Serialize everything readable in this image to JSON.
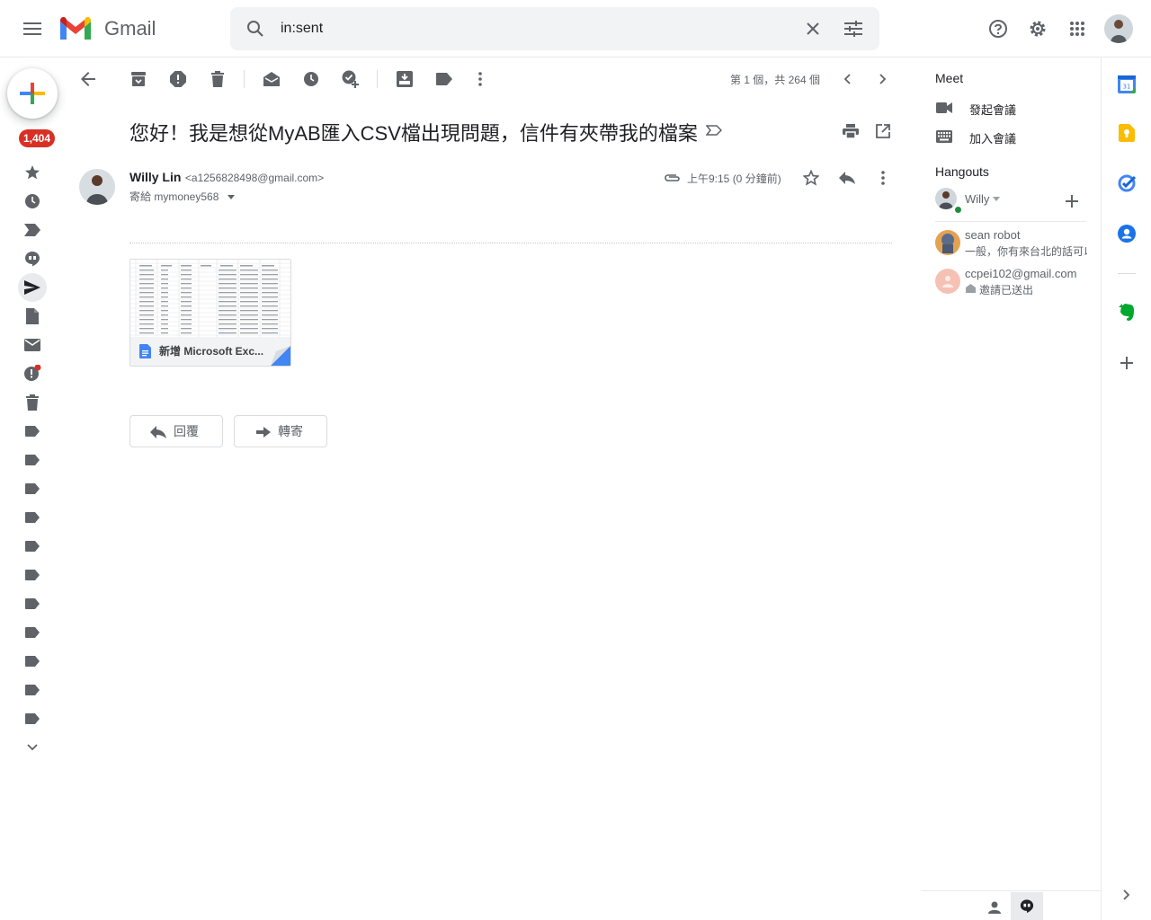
{
  "header": {
    "app_name": "Gmail",
    "search": {
      "value": "in:sent"
    }
  },
  "left_rail": {
    "unread_badge": "1,404"
  },
  "toolbar": {
    "pager": "第 1 個，共 264 個"
  },
  "message": {
    "subject": "您好！我是想從MyAB匯入CSV檔出現問題，信件有夾帶我的檔案",
    "sender_name": "Willy Lin",
    "sender_email": "<a1256828498@gmail.com>",
    "to_line": "寄給 mymoney568",
    "time": "上午9:15 (0 分鐘前)",
    "attachment": {
      "name": "新增 Microsoft Exc..."
    },
    "reply_label": "回覆",
    "forward_label": "轉寄"
  },
  "right_panel": {
    "meet_title": "Meet",
    "start_meeting": "發起會議",
    "join_meeting": "加入會議",
    "hangouts_title": "Hangouts",
    "me": "Willy",
    "contacts": [
      {
        "name": "sean robot",
        "preview": "一般，你有來台北的話可以"
      },
      {
        "name": "ccpei102@gmail.com",
        "preview": "邀請已送出"
      }
    ]
  },
  "colors": {
    "accent_red": "#d93025",
    "text": "#202124",
    "muted": "#5f6368"
  }
}
